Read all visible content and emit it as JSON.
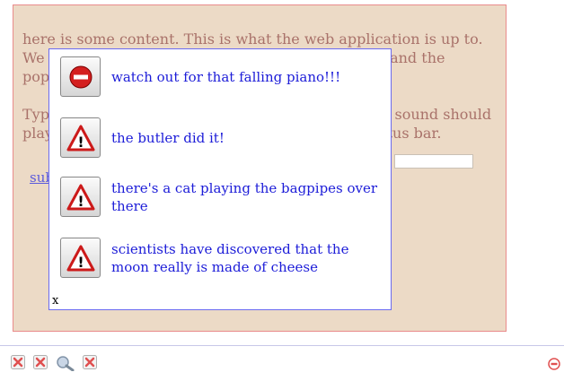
{
  "content": {
    "paragraph_1": "here is some content. This is what the web application is up to. We want the status bar to display these messages and the popups to show over it.",
    "paragraph_2": "Type something in the box and click on 'submit'. A sound should play, then the message should be noted on the status bar.",
    "submit_link": "submit"
  },
  "popup": {
    "messages": [
      {
        "text": "watch out for that falling piano!!!",
        "icon": "stop-icon"
      },
      {
        "text": "the butler did it!",
        "icon": "warning-icon"
      },
      {
        "text": "there's a cat playing the bagpipes over there",
        "icon": "warning-icon"
      },
      {
        "text": "scientists have discovered that the moon really is made of cheese",
        "icon": "warning-icon"
      }
    ],
    "close_label": "x"
  },
  "statusbar": {
    "icons": [
      "dismiss-icon",
      "dismiss-icon",
      "magnifier-icon",
      "dismiss-icon"
    ],
    "right_icon": "stop-icon"
  },
  "colors": {
    "panel_bg": "#ecdac6",
    "panel_border": "#e98b8b",
    "popup_text": "#1c1cd8",
    "stop_red": "#d42020",
    "warning_red": "#cc1a1a"
  }
}
